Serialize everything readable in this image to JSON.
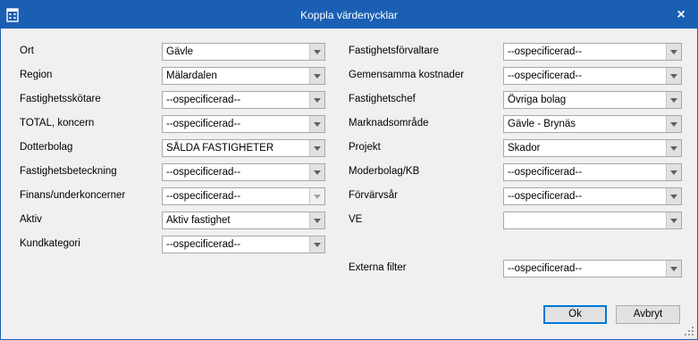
{
  "window": {
    "title": "Koppla värdenycklar",
    "close_glyph": "×",
    "app_icon": "building-icon"
  },
  "left": [
    {
      "label": "Ort",
      "value": "Gävle"
    },
    {
      "label": "Region",
      "value": "Mälardalen"
    },
    {
      "label": "Fastighetsskötare",
      "value": "--ospecificerad--"
    },
    {
      "label": "TOTAL, koncern",
      "value": "--ospecificerad--"
    },
    {
      "label": "Dotterbolag",
      "value": "SÅLDA  FASTIGHETER"
    },
    {
      "label": "Fastighetsbeteckning",
      "value": "--ospecificerad--"
    },
    {
      "label": "Finans/underkoncerner",
      "value": "--ospecificerad--"
    },
    {
      "label": "Aktiv",
      "value": "Aktiv fastighet"
    },
    {
      "label": "Kundkategori",
      "value": "--ospecificerad--"
    }
  ],
  "right": [
    {
      "label": "Fastighetsförvaltare",
      "value": "--ospecificerad--"
    },
    {
      "label": "Gemensamma kostnader",
      "value": "--ospecificerad--"
    },
    {
      "label": "Fastighetschef",
      "value": "Övriga bolag"
    },
    {
      "label": "Marknadsområde",
      "value": "Gävle - Brynäs"
    },
    {
      "label": "Projekt",
      "value": "Skador"
    },
    {
      "label": "Moderbolag/KB",
      "value": "--ospecificerad--"
    },
    {
      "label": "Förvärvsår",
      "value": "--ospecificerad--"
    },
    {
      "label": "VE",
      "value": ""
    }
  ],
  "external_filter": {
    "label": "Externa filter",
    "value": "--ospecificerad--"
  },
  "buttons": {
    "ok": "Ok",
    "cancel": "Avbryt"
  }
}
